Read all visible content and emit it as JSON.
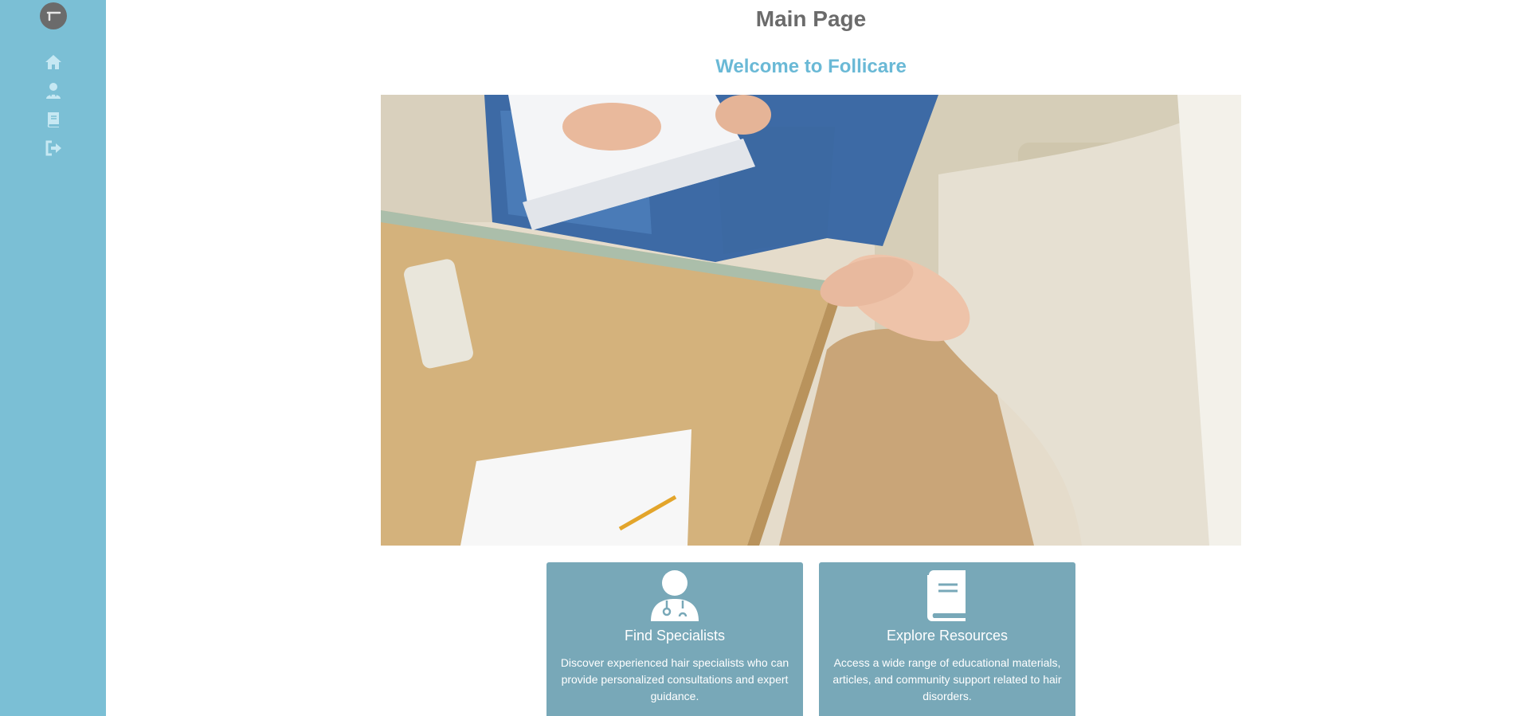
{
  "sidebar": {
    "logo_icon": "app-logo-icon",
    "items": [
      {
        "name": "home",
        "icon": "home-icon"
      },
      {
        "name": "profile",
        "icon": "user-icon"
      },
      {
        "name": "resources",
        "icon": "book-icon"
      },
      {
        "name": "logout",
        "icon": "logout-icon"
      }
    ],
    "colors": {
      "background": "#7bbfd5",
      "icon": "#c6e8f3",
      "logo": "#6b6b6b"
    }
  },
  "main": {
    "page_title": "Main Page",
    "welcome": "Welcome to Follicare",
    "hero_image": "consultation-photo"
  },
  "cards": [
    {
      "icon": "doctor-icon",
      "title": "Find Specialists",
      "text": "Discover experienced hair specialists who can provide personalized consultations and expert guidance."
    },
    {
      "icon": "book-icon",
      "title": "Explore Resources",
      "text": "Access a wide range of educational materials, articles, and community support related to hair disorders."
    }
  ],
  "colors": {
    "title": "#6b6b6b",
    "accent": "#6ab9d6",
    "card": "#78a8b8"
  }
}
